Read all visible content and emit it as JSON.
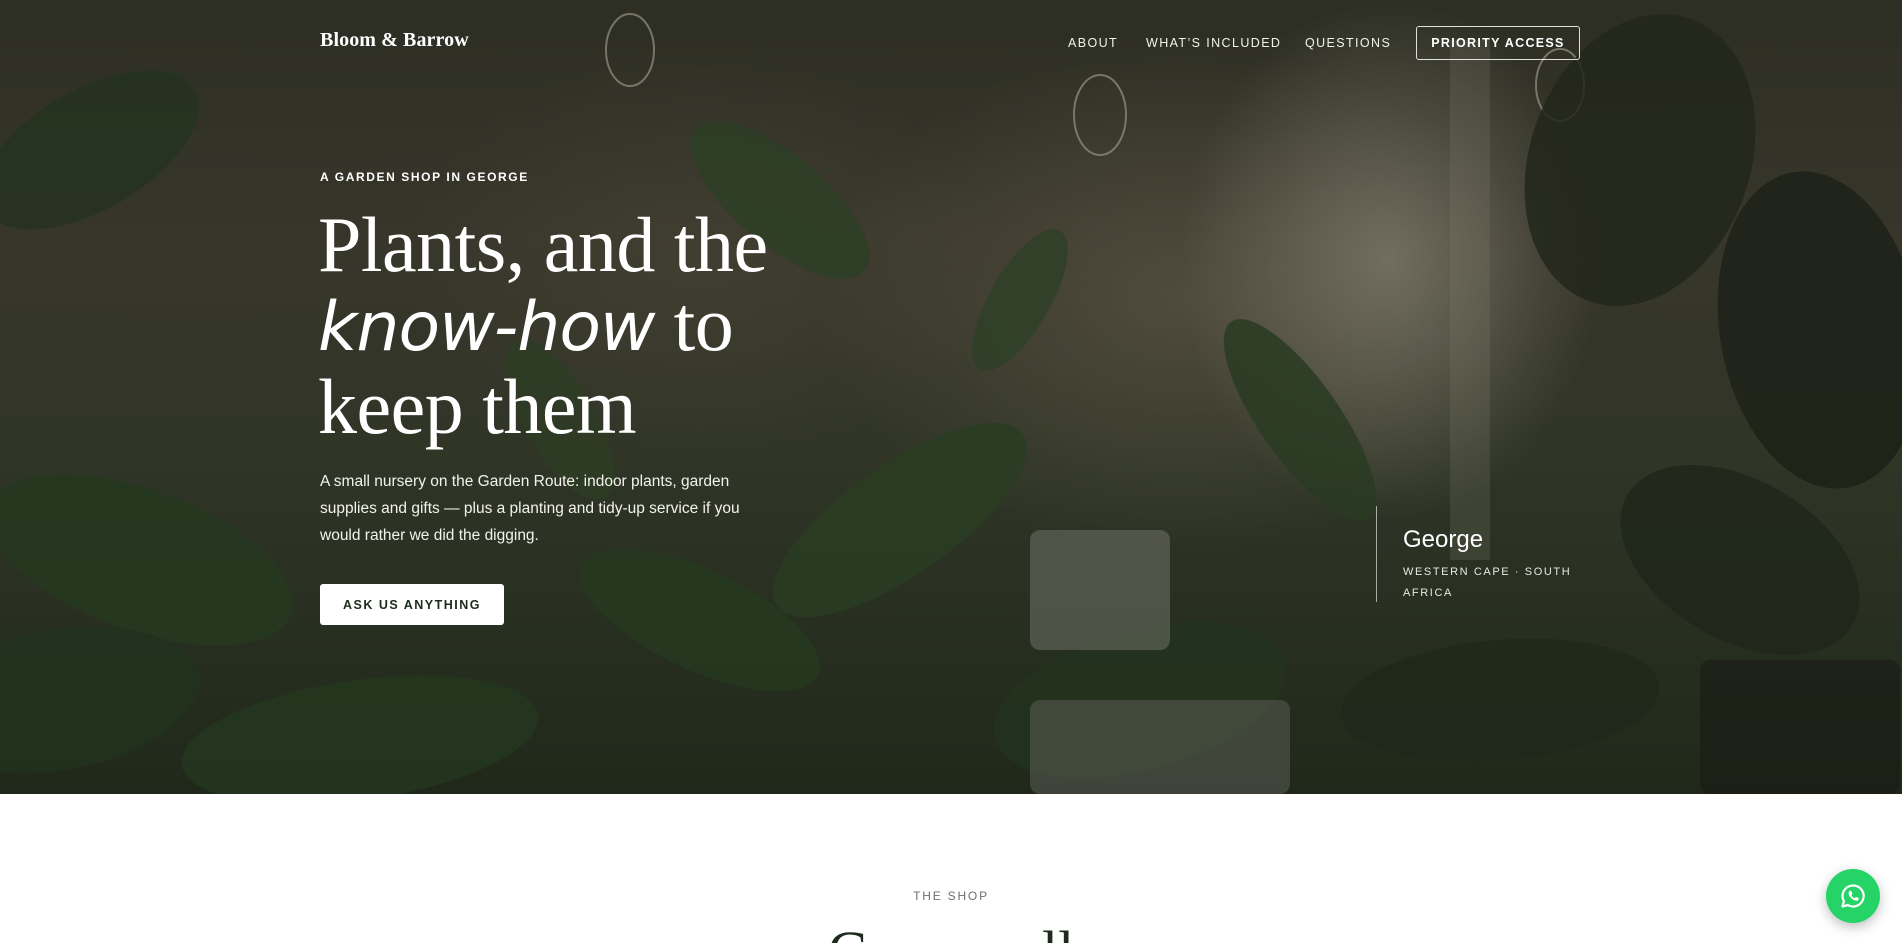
{
  "brand": {
    "logo_text": "Bloom & Barrow"
  },
  "nav": {
    "items": [
      {
        "label": "ABOUT"
      },
      {
        "label": "WHAT’S INCLUDED"
      },
      {
        "label": "QUESTIONS"
      }
    ],
    "cta_label": "PRIORITY ACCESS"
  },
  "hero": {
    "eyebrow": "A GARDEN SHOP IN GEORGE",
    "headline_line1": "Plants, and the",
    "headline_line2_italic": "know-how",
    "headline_line2_rest": " to",
    "headline_line3": "keep them",
    "lede": "A small nursery on the Garden Route: indoor plants, garden supplies and gifts — plus a planting and tidy-up service if you would rather we did the digging.",
    "cta_label": "ASK US ANYTHING",
    "location": {
      "city": "George",
      "region": "WESTERN CAPE · SOUTH AFRICA"
    }
  },
  "shop_section": {
    "eyebrow": "THE SHOP",
    "title": "Grow well"
  },
  "floating": {
    "icon": "whatsapp-icon"
  },
  "colors": {
    "white": "#ffffff",
    "whatsapp_green": "#25d366",
    "text_dark": "#1f2a1f"
  }
}
